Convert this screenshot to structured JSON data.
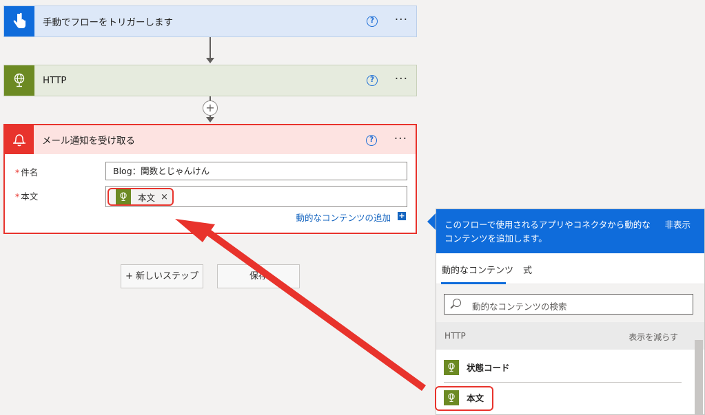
{
  "flow": {
    "trigger": {
      "title": "手動でフローをトリガーします",
      "help": "?",
      "more": "···"
    },
    "http": {
      "title": "HTTP",
      "help": "?",
      "more": "···"
    },
    "add_step": "+",
    "email": {
      "title": "メール通知を受け取る",
      "help": "?",
      "more": "···",
      "fields": {
        "subject": {
          "required": "*",
          "label": "件名",
          "value": "Blog：関数とじゃんけん"
        },
        "body": {
          "required": "*",
          "label": "本文",
          "token_label": "本文",
          "token_close": "×"
        }
      },
      "add_dynamic": "動的なコンテンツの追加",
      "add_dynamic_plus": "+"
    },
    "buttons": {
      "new_step": "+ 新しいステップ",
      "save": "保存"
    }
  },
  "dynamic_panel": {
    "banner": "このフローで使用されるアプリやコネクタから動的なコンテンツを追加します。",
    "hide": "非表示",
    "tabs": [
      "動的なコンテンツ",
      "式"
    ],
    "active_tab": 0,
    "search_placeholder": "動的なコンテンツの検索",
    "group": {
      "title": "HTTP",
      "see_less": "表示を減らす"
    },
    "items": [
      "状態コード",
      "本文"
    ]
  },
  "colors": {
    "trigger": "#0f6cdb",
    "http": "#6c8a23",
    "email": "#e8332c",
    "annotation": "#e8332c",
    "link": "#1565c0"
  },
  "icons": {
    "trigger": "touch-hand-icon",
    "http": "globe-icon",
    "email": "bell-icon",
    "token": "globe-icon",
    "search": "search-icon"
  }
}
